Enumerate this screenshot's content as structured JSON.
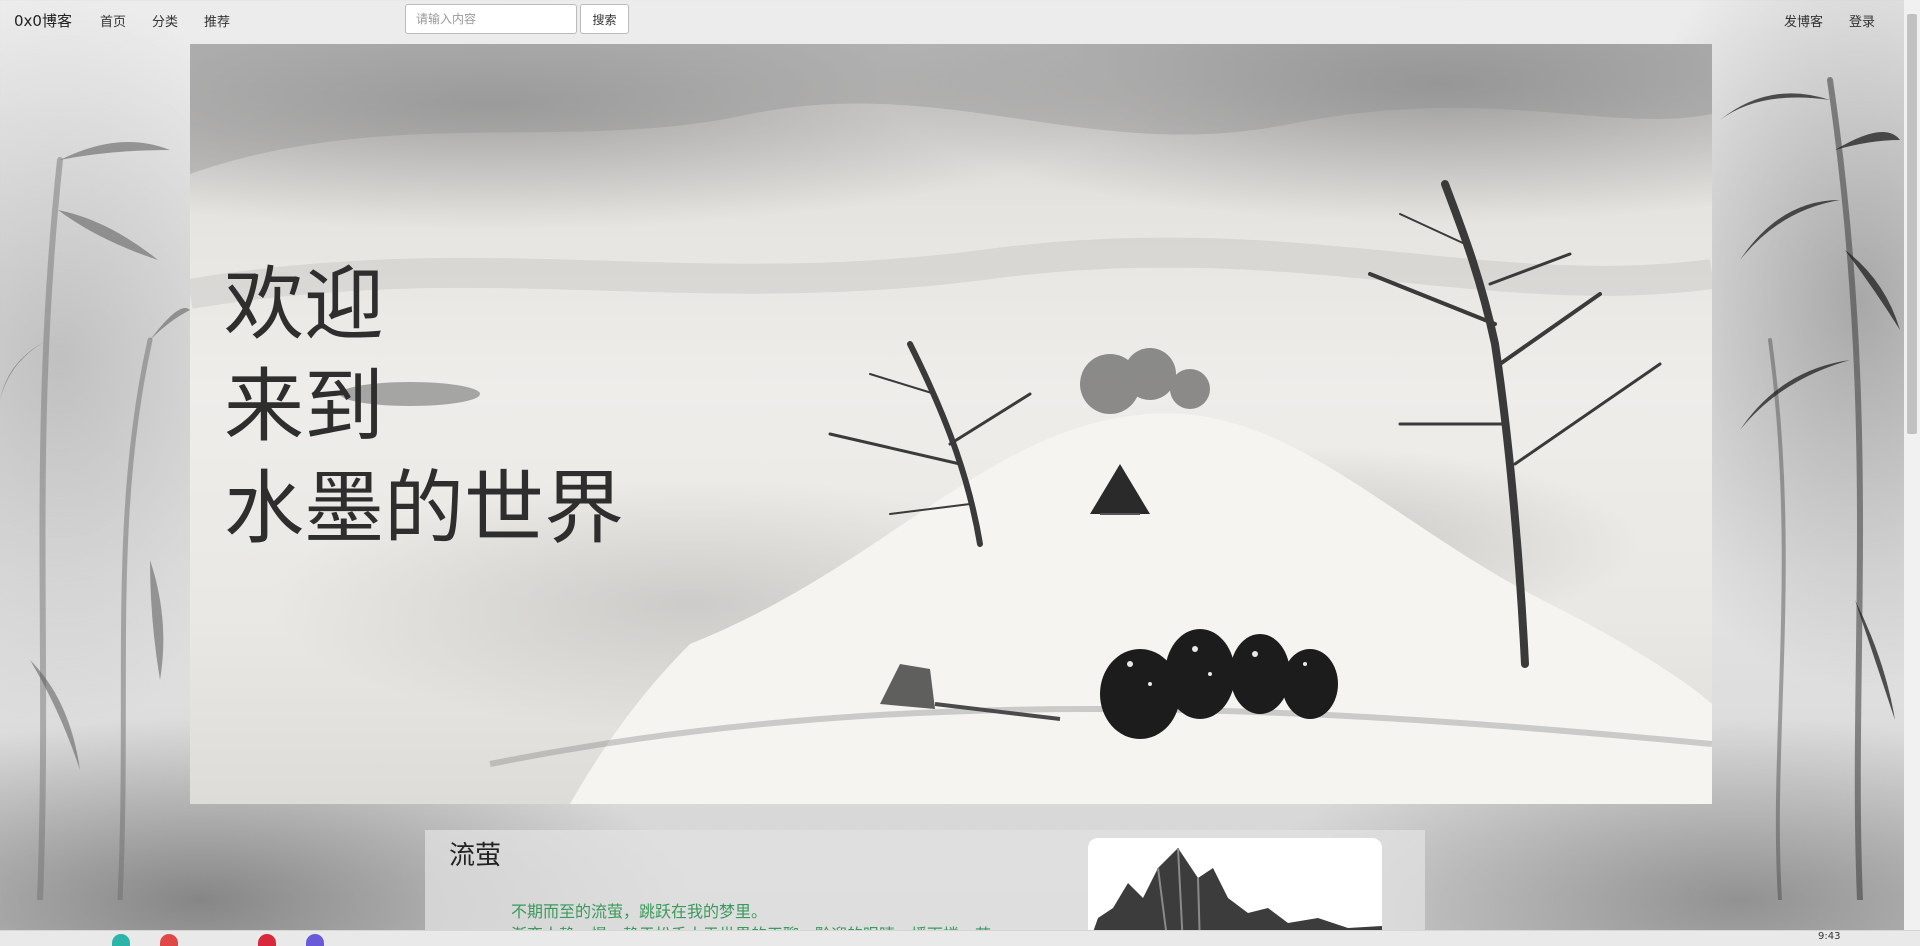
{
  "navbar": {
    "brand": "0x0博客",
    "links": [
      "首页",
      "分类",
      "推荐"
    ],
    "search_placeholder": "请输入内容",
    "search_button": "搜索",
    "right_links": [
      "发博客",
      "登录"
    ]
  },
  "hero": {
    "lines": [
      "欢迎",
      "来到",
      "水墨的世界"
    ]
  },
  "post": {
    "title": "流萤",
    "lines": [
      "不期而至的流萤，跳跃在我的梦里。",
      "渐变人静，慢，静于松手大于世界的天聊，黔迎的眼睛，播雨楼，苗"
    ]
  },
  "taskbar": {
    "clock": "9:43"
  }
}
